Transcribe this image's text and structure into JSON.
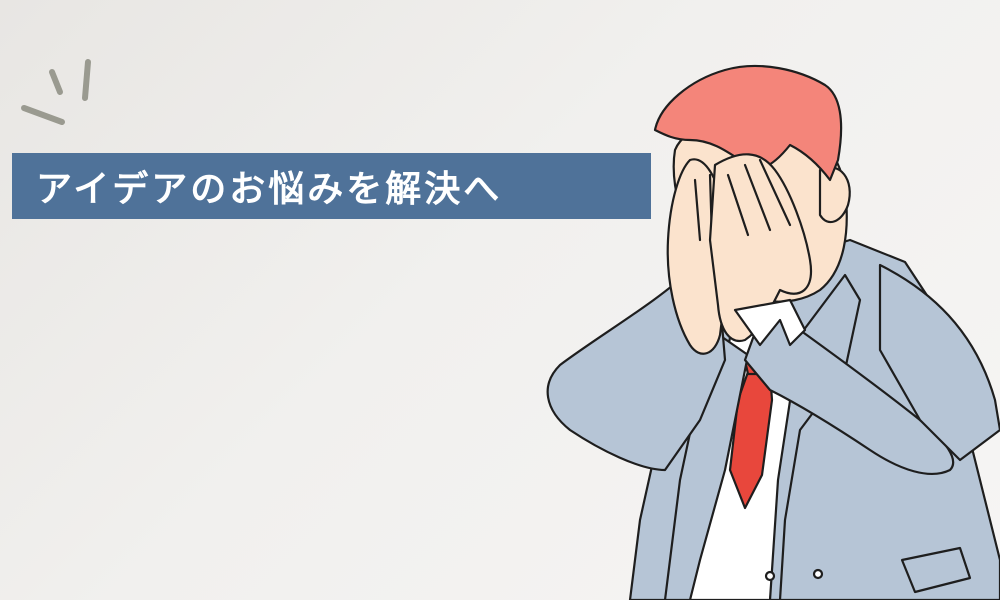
{
  "banner": {
    "heading": "アイデアのお悩みを解決へ",
    "background_color": "#4f7299",
    "text_color": "#ffffff"
  },
  "illustration": {
    "subject": "man-covering-face-icon",
    "colors": {
      "hair": "#f4857a",
      "skin": "#fbe3cd",
      "suit": "#b6c5d6",
      "shirt": "#ffffff",
      "tie": "#e8473c",
      "outline": "#1e1e1e"
    }
  },
  "decoration": {
    "emphasis_marks": "emphasis-lines-icon",
    "color": "#9a9a90"
  }
}
